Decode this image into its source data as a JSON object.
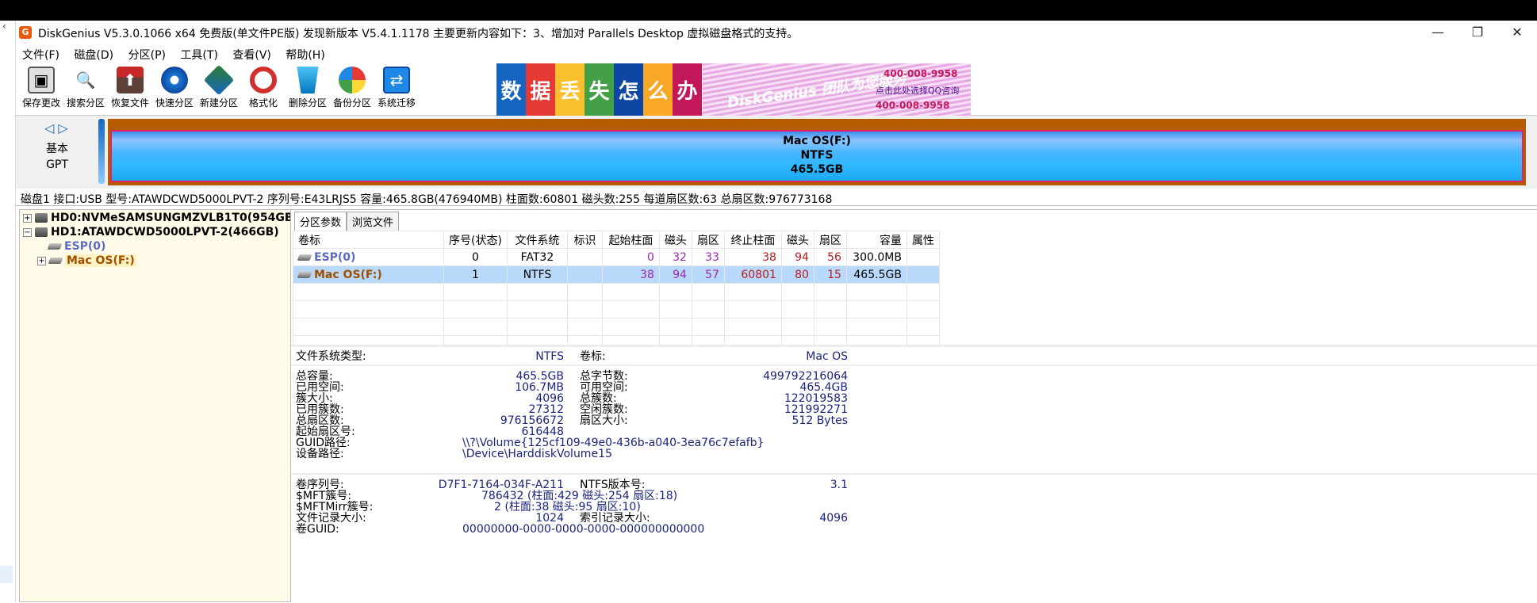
{
  "app": {
    "title": "DiskGenius V5.3.0.1066 x64 免费版(单文件PE版)  发现新版本 V5.4.1.1178 主要更新内容如下：3、增加对 Parallels Desktop 虚拟磁盘格式的支持。"
  },
  "menu": [
    "文件(F)",
    "磁盘(D)",
    "分区(P)",
    "工具(T)",
    "查看(V)",
    "帮助(H)"
  ],
  "toolbar": {
    "buttons": [
      {
        "label": "保存更改",
        "icon": "save-disk-icon"
      },
      {
        "label": "搜索分区",
        "icon": "magnifier-icon"
      },
      {
        "label": "恢复文件",
        "icon": "recover-icon"
      },
      {
        "label": "快速分区",
        "icon": "quick-partition-icon"
      },
      {
        "label": "新建分区",
        "icon": "new-partition-icon"
      },
      {
        "label": "格式化",
        "icon": "format-icon"
      },
      {
        "label": "删除分区",
        "icon": "trash-icon"
      },
      {
        "label": "备份分区",
        "icon": "backup-icon"
      },
      {
        "label": "系统迁移",
        "icon": "migrate-icon"
      }
    ],
    "banner": {
      "tiles": [
        "数",
        "据",
        "丢",
        "失",
        "怎",
        "么",
        "办"
      ],
      "brand": "DiskGenius 团队为您服务",
      "phone1": "400-008-9958",
      "qq": "点击此处选择QQ咨询",
      "phone2": "400-008-9958"
    }
  },
  "diskmap": {
    "layout_type": "基本",
    "table_type": "GPT",
    "partition_name": "Mac OS(F:)",
    "partition_fs": "NTFS",
    "partition_size": "465.5GB"
  },
  "disk_info": "磁盘1 接口:USB  型号:ATAWDCWD5000LPVT-2  序列号:E43LRJS5  容量:465.8GB(476940MB)  柱面数:60801  磁头数:255  每道扇区数:63  总扇区数:976773168",
  "tree": {
    "hd0": "HD0:NVMeSAMSUNGMZVLB1T0(954GB)",
    "hd1": "HD1:ATAWDCWD5000LPVT-2(466GB)",
    "esp": "ESP(0)",
    "mac": "Mac OS(F:)"
  },
  "tabs": [
    "分区参数",
    "浏览文件"
  ],
  "table": {
    "headers": [
      "卷标",
      "序号(状态)",
      "文件系统",
      "标识",
      "起始柱面",
      "磁头",
      "扇区",
      "终止柱面",
      "磁头",
      "扇区",
      "容量",
      "属性"
    ],
    "rows": [
      {
        "label": "ESP(0)",
        "index": "0",
        "fs": "FAT32",
        "id": "",
        "start_cyl": "0",
        "start_head": "32",
        "start_sec": "33",
        "end_cyl": "38",
        "end_head": "94",
        "end_sec": "56",
        "size": "300.0MB",
        "attr": ""
      },
      {
        "label": "Mac OS(F:)",
        "index": "1",
        "fs": "NTFS",
        "id": "",
        "start_cyl": "38",
        "start_head": "94",
        "start_sec": "57",
        "end_cyl": "60801",
        "end_head": "80",
        "end_sec": "15",
        "size": "465.5GB",
        "attr": ""
      }
    ]
  },
  "details": {
    "fs_type_label": "文件系统类型:",
    "fs_type": "NTFS",
    "vol_label_label": "卷标:",
    "vol_label": "Mac OS",
    "total_cap_label": "总容量:",
    "total_cap": "465.5GB",
    "total_bytes_label": "总字节数:",
    "total_bytes": "499792216064",
    "used_label": "已用空间:",
    "used": "106.7MB",
    "free_label": "可用空间:",
    "free": "465.4GB",
    "cluster_size_label": "簇大小:",
    "cluster_size": "4096",
    "total_clusters_label": "总簇数:",
    "total_clusters": "122019583",
    "used_clusters_label": "已用簇数:",
    "used_clusters": "27312",
    "free_clusters_label": "空闲簇数:",
    "free_clusters": "121992271",
    "total_sectors_label": "总扇区数:",
    "total_sectors": "976156672",
    "sector_size_label": "扇区大小:",
    "sector_size": "512 Bytes",
    "start_sector_label": "起始扇区号:",
    "start_sector": "616448",
    "guid_path_label": "GUID路径:",
    "guid_path": "\\\\?\\Volume{125cf109-49e0-436b-a040-3ea76c7efafb}",
    "device_path_label": "设备路径:",
    "device_path": "\\Device\\HarddiskVolume15",
    "serial_label": "卷序列号:",
    "serial": "D7F1-7164-034F-A211",
    "ntfs_ver_label": "NTFS版本号:",
    "ntfs_ver": "3.1",
    "mft_label": "$MFT簇号:",
    "mft": "786432 (柱面:429 磁头:254 扇区:18)",
    "mftmirr_label": "$MFTMirr簇号:",
    "mftmirr": "2 (柱面:38 磁头:95 扇区:10)",
    "file_rec_label": "文件记录大小:",
    "file_rec": "1024",
    "index_rec_label": "索引记录大小:",
    "index_rec": "4096",
    "vol_guid_label": "卷GUID:",
    "vol_guid": "00000000-0000-0000-0000-000000000000"
  },
  "colors": {
    "partition_outer": "#b35c00",
    "partition_border": "#e91e63",
    "partition_fill": "#2fb8ff",
    "selected_row": "#b9d9fb",
    "tree_bg": "#fffbe8",
    "value_text": "#1a237e"
  }
}
